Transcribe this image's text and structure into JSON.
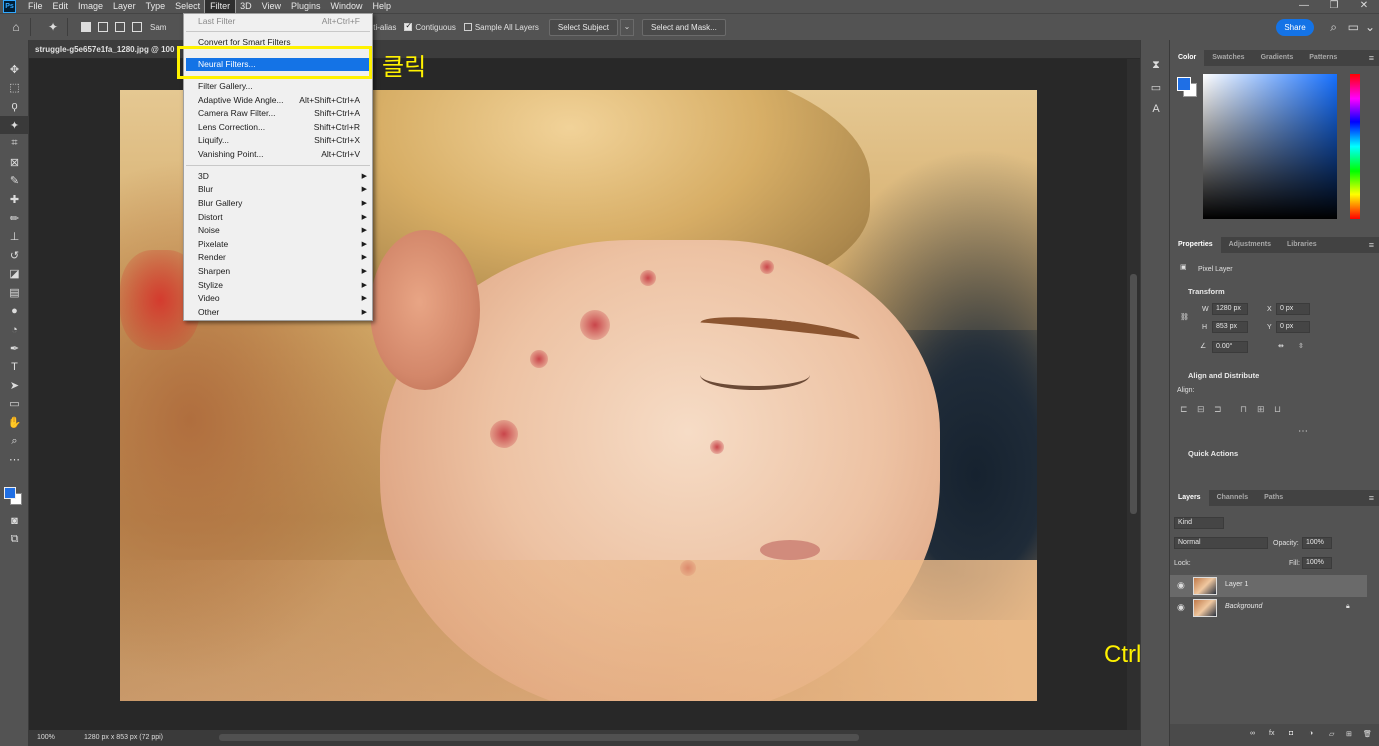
{
  "menubar": {
    "logo": "Ps",
    "items": [
      "File",
      "Edit",
      "Image",
      "Layer",
      "Type",
      "Select",
      "Filter",
      "3D",
      "View",
      "Plugins",
      "Window",
      "Help"
    ],
    "active_item": "Filter",
    "window_controls": [
      "—",
      "❐",
      "✕"
    ]
  },
  "options_bar": {
    "sample_label": "Sam",
    "anti_alias": {
      "label": "Anti-alias",
      "checked": true
    },
    "contiguous": {
      "label": "Contiguous",
      "checked": true
    },
    "sample_all_layers": {
      "label": "Sample All Layers",
      "checked": false
    },
    "select_subject": "Select Subject",
    "select_and_mask": "Select and Mask...",
    "share": "Share"
  },
  "document": {
    "tab_title": "struggle-g5e657e1fa_1280.jpg @ 100",
    "zoom": "100%",
    "dimensions": "1280 px x 853 px (72 ppi)"
  },
  "filter_menu": {
    "items": [
      {
        "label": "Last Filter",
        "shortcut": "Alt+Ctrl+F",
        "disabled": true
      },
      {
        "label": "Convert for Smart Filters",
        "shortcut": ""
      },
      {
        "label": "Neural Filters...",
        "shortcut": "",
        "highlighted": true
      },
      {
        "label": "Filter Gallery...",
        "shortcut": ""
      },
      {
        "label": "Adaptive Wide Angle...",
        "shortcut": "Alt+Shift+Ctrl+A"
      },
      {
        "label": "Camera Raw Filter...",
        "shortcut": "Shift+Ctrl+A"
      },
      {
        "label": "Lens Correction...",
        "shortcut": "Shift+Ctrl+R"
      },
      {
        "label": "Liquify...",
        "shortcut": "Shift+Ctrl+X"
      },
      {
        "label": "Vanishing Point...",
        "shortcut": "Alt+Ctrl+V"
      },
      {
        "label": "3D",
        "submenu": true
      },
      {
        "label": "Blur",
        "submenu": true
      },
      {
        "label": "Blur Gallery",
        "submenu": true
      },
      {
        "label": "Distort",
        "submenu": true
      },
      {
        "label": "Noise",
        "submenu": true
      },
      {
        "label": "Pixelate",
        "submenu": true
      },
      {
        "label": "Render",
        "submenu": true
      },
      {
        "label": "Sharpen",
        "submenu": true
      },
      {
        "label": "Stylize",
        "submenu": true
      },
      {
        "label": "Video",
        "submenu": true
      },
      {
        "label": "Other",
        "submenu": true
      }
    ]
  },
  "annotations": {
    "click_note": "클릭",
    "copy_note": "Ctrl + J 레이어 복사"
  },
  "panels": {
    "color_tabs": [
      "Color",
      "Swatches",
      "Gradients",
      "Patterns"
    ],
    "properties_tabs": [
      "Properties",
      "Adjustments",
      "Libraries"
    ],
    "pixel_layer": "Pixel Layer",
    "transform": {
      "title": "Transform",
      "w_label": "W",
      "w": "1280 px",
      "h_label": "H",
      "h": "853 px",
      "x_label": "X",
      "x": "0 px",
      "y_label": "Y",
      "y": "0 px",
      "angle": "0.00°"
    },
    "align": {
      "title": "Align and Distribute",
      "sub": "Align:"
    },
    "quick_actions": "Quick Actions",
    "layers_tabs": [
      "Layers",
      "Channels",
      "Paths"
    ],
    "kind": "Kind",
    "blend_mode": "Normal",
    "opacity_label": "Opacity:",
    "opacity": "100%",
    "lock_label": "Lock:",
    "fill_label": "Fill:",
    "fill": "100%",
    "layers": [
      {
        "name": "Layer 1",
        "selected": true
      },
      {
        "name": "Background",
        "locked": true
      }
    ]
  },
  "colors": {
    "accent": "#1473e6",
    "annotation": "#fff200",
    "foreground": "#1f6fe5",
    "background": "#ffffff"
  }
}
